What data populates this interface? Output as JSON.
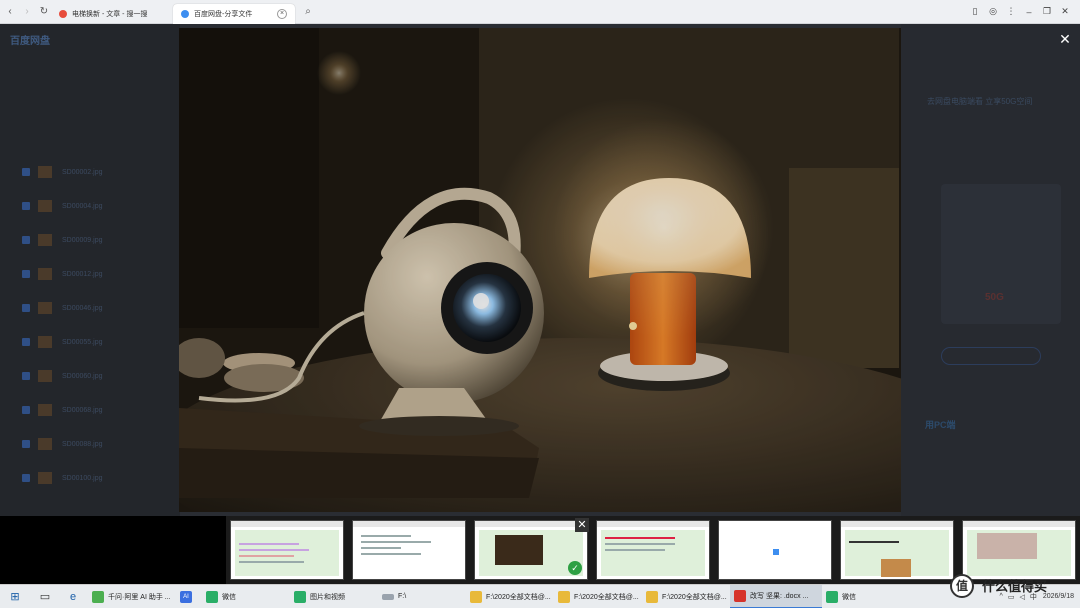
{
  "browser": {
    "tabs": [
      {
        "title": "电梯换新 - 文章 - 搜一搜",
        "active": false
      },
      {
        "title": "百度网盘-分享文件",
        "active": true
      }
    ]
  },
  "background_page": {
    "logo": "百度网盘",
    "files": [
      "SD00002.jpg",
      "SD00004.jpg",
      "SD00009.jpg",
      "SD00012.jpg",
      "SD00046.jpg",
      "SD00055.jpg",
      "SD00060.jpg",
      "SD00068.jpg",
      "SD00088.jpg",
      "SD00100.jpg"
    ],
    "promo_title": "去网盘电脑端看 立享50G空间",
    "promo_size": "50G",
    "promo_pc": "用PC端"
  },
  "viewer": {
    "close_icon": "close-icon",
    "image_description_icon": "photo-image"
  },
  "switcher": {
    "thumbnails": 7,
    "selected_index": 2
  },
  "taskbar": {
    "apps": [
      {
        "label": "千问·阿里 AI 助手 ...",
        "color": "#4caf50"
      },
      {
        "label": "",
        "color": "#3b6fe0",
        "short": "AI"
      },
      {
        "label": "微信",
        "color": "#2aae67"
      },
      {
        "label": "图片和视频",
        "color": "#2aae67"
      },
      {
        "label": "F:\\",
        "color": "#9aa3ad"
      },
      {
        "label": "F:\\2020全部文档@...",
        "color": "#e8b93a"
      },
      {
        "label": "F:\\2020全部文档@...",
        "color": "#e8b93a"
      },
      {
        "label": "F:\\2020全部文档@...",
        "color": "#e8b93a"
      },
      {
        "label": "改写 坚果: .docx ...",
        "color": "#d6342b"
      },
      {
        "label": "微信",
        "color": "#2aae67"
      }
    ],
    "tray_ime": "中",
    "clock_date": "2026/9/18"
  },
  "watermark": {
    "symbol": "值",
    "text": "什么值得买"
  }
}
